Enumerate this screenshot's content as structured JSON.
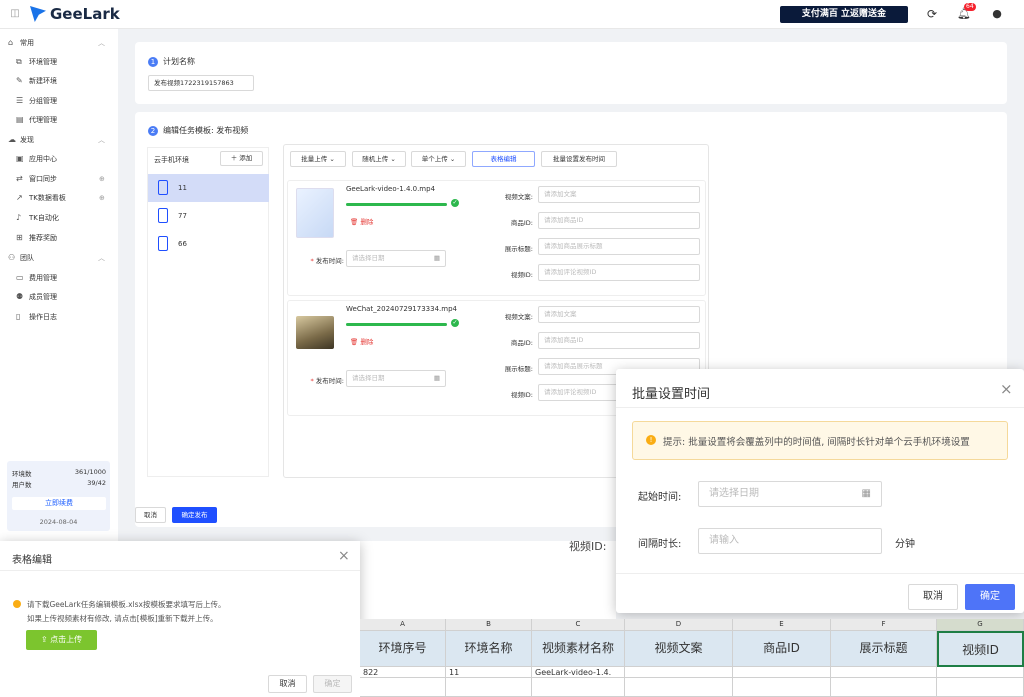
{
  "topbar": {
    "brand": "GeeLark",
    "promo": "支付满百 立返赠送金",
    "notification_count": "64"
  },
  "sidebar": {
    "sections": [
      {
        "label": "常用",
        "items": [
          "环境管理",
          "新建环境",
          "分组管理",
          "代理管理"
        ]
      },
      {
        "label": "发现",
        "items": [
          "应用中心",
          "窗口同步",
          "TK数据看板",
          "TK自动化",
          "推荐奖励"
        ]
      },
      {
        "label": "团队",
        "items": [
          "费用管理",
          "成员管理",
          "操作日志"
        ]
      }
    ],
    "stats": {
      "env_label": "环境数",
      "env_value": "361/1000",
      "user_label": "用户数",
      "user_value": "39/42",
      "renew": "立即续费",
      "date": "2024-08-04"
    }
  },
  "plan": {
    "step": "1",
    "label": "计划名称",
    "value": "发布视频1722319157863"
  },
  "task": {
    "step": "2",
    "label": "编辑任务模板: 发布视频",
    "env_header": "云手机环境",
    "add_button": "添加",
    "envs": [
      "11",
      "77",
      "66"
    ],
    "toolbar": [
      "批量上传",
      "随机上传",
      "单个上传",
      "表格编辑",
      "批量设置发布时间"
    ],
    "videos": [
      {
        "name": "GeeLark-video-1.4.0.mp4",
        "progress": 100
      },
      {
        "name": "WeChat_20240729173334.mp4",
        "progress": 100
      }
    ],
    "delete": "删除",
    "publish_time_label": "发布时间:",
    "publish_time_placeholder": "请选择日期",
    "fields": [
      {
        "label": "视频文案:",
        "placeholder": "请添加文案"
      },
      {
        "label": "商品ID:",
        "placeholder": "请添加商品ID"
      },
      {
        "label": "展示标题:",
        "placeholder": "请添加商品展示标题"
      },
      {
        "label": "视频ID:",
        "placeholder": "请添加评论视频ID"
      }
    ]
  },
  "footer": {
    "cancel": "取消",
    "submit": "确定发布"
  },
  "bg_fragment": "视频ID:",
  "batch_time_modal": {
    "title": "批量设置时间",
    "tip": "提示: 批量设置将会覆盖列中的时间值, 间隔时长针对单个云手机环境设置",
    "start_label": "起始时间:",
    "start_placeholder": "请选择日期",
    "interval_label": "间隔时长:",
    "interval_placeholder": "请输入",
    "unit": "分钟",
    "cancel": "取消",
    "ok": "确定"
  },
  "table_modal": {
    "title": "表格编辑",
    "line1": "请下载GeeLark任务编辑模板.xlsx按模板要求填写后上传。",
    "line2": "如果上传视频素材有修改, 请点击[模板]重新下载并上传。",
    "upload": "点击上传",
    "cancel": "取消",
    "ok": "确定"
  },
  "spreadsheet": {
    "columns": [
      "A",
      "B",
      "C",
      "D",
      "E",
      "F",
      "G"
    ],
    "headers": [
      "环境序号",
      "环境名称",
      "视频素材名称",
      "视频文案",
      "商品ID",
      "展示标题",
      "视频ID"
    ],
    "row": [
      "822",
      "11",
      "GeeLark-video-1.4.",
      "",
      "",
      "",
      ""
    ]
  },
  "colors": {
    "primary": "#1f4fff",
    "success": "#2db84d",
    "danger": "#e53935",
    "upload_green": "#7cc52e"
  }
}
